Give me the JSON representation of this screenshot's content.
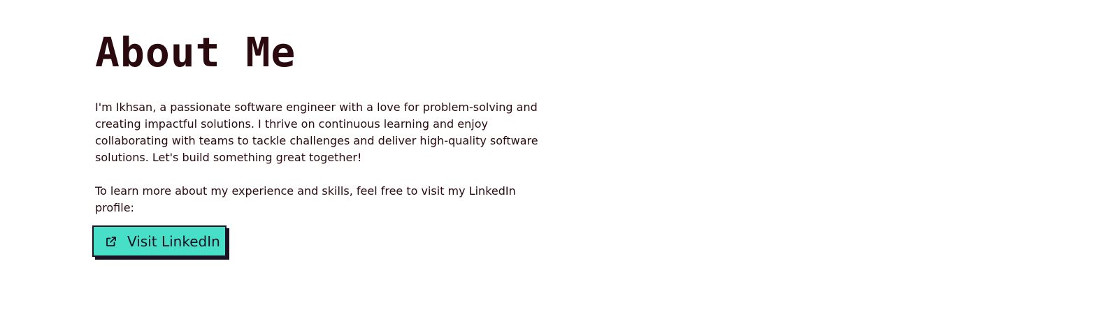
{
  "about": {
    "title": "About Me",
    "paragraph_1": "I'm Ikhsan, a passionate software engineer with a love for problem-solving and creating impactful solutions. I thrive on continuous learning and enjoy collaborating with teams to tackle challenges and deliver high-quality software solutions. Let's build something great together!",
    "paragraph_2": "To learn more about my experience and skills, feel free to visit my LinkedIn profile:",
    "button": {
      "label": "Visit LinkedIn",
      "icon": "external-link-icon"
    }
  },
  "colors": {
    "text": "#2a0a0e",
    "button_bg": "#48dfc8",
    "button_border": "#1a1222"
  }
}
